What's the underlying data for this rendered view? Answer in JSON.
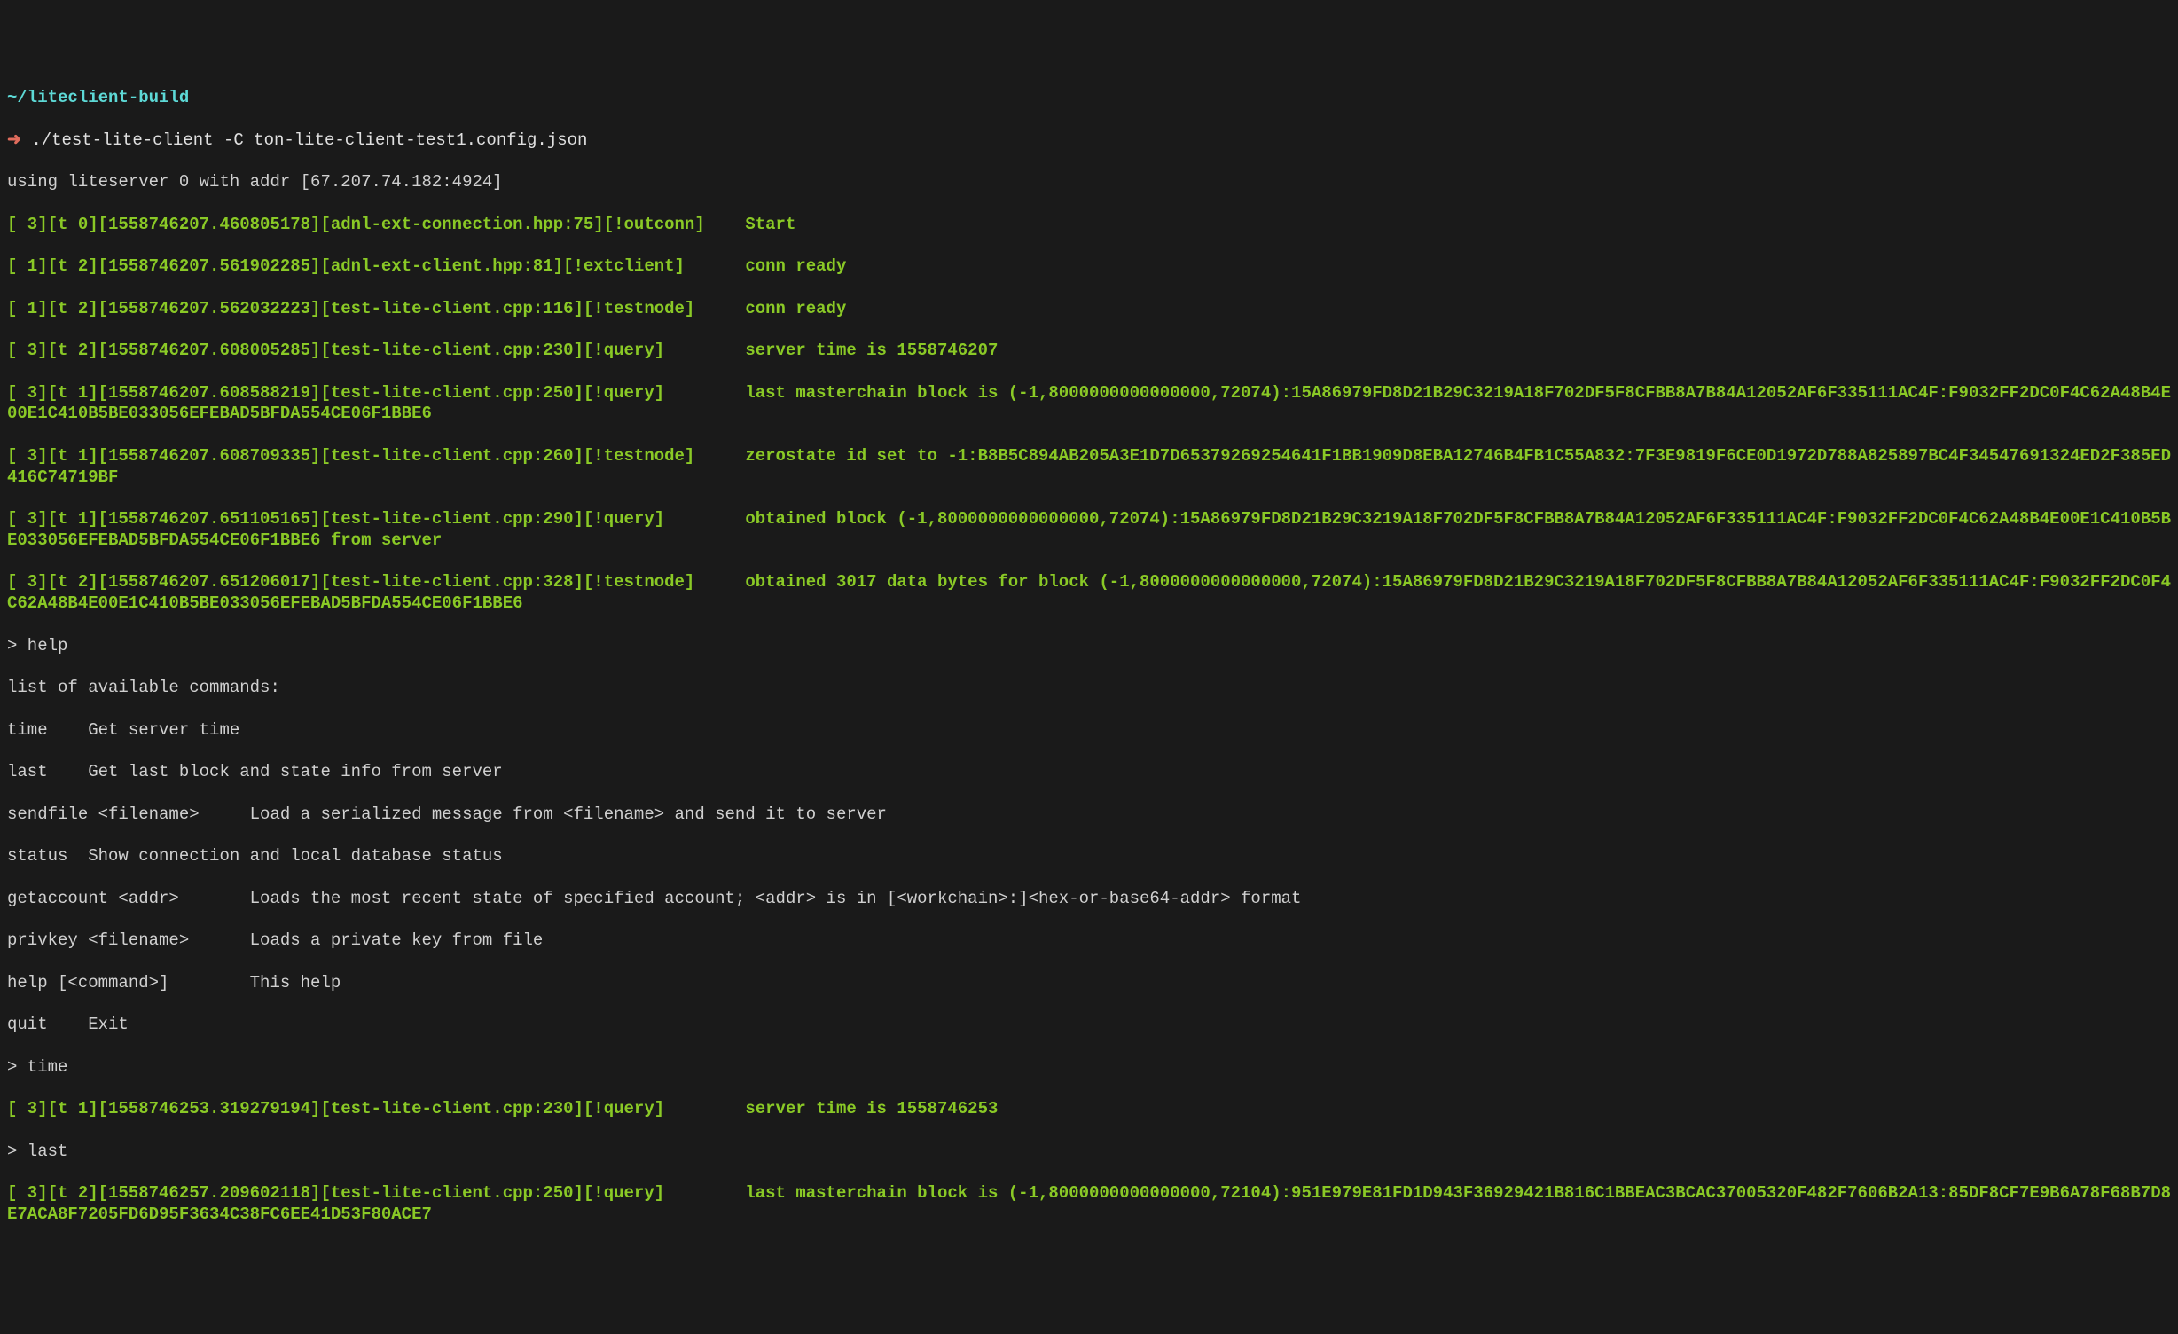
{
  "prompt": {
    "cwd": "~/liteclient-build",
    "arrow": "➜",
    "command": "./test-lite-client -C ton-lite-client-test1.config.json"
  },
  "startup": {
    "using": "using liteserver 0 with addr [67.207.74.182:4924]"
  },
  "logs": {
    "l1": "[ 3][t 0][1558746207.460805178][adnl-ext-connection.hpp:75][!outconn]    Start",
    "l2": "[ 1][t 2][1558746207.561902285][adnl-ext-client.hpp:81][!extclient]      conn ready",
    "l3": "[ 1][t 2][1558746207.562032223][test-lite-client.cpp:116][!testnode]     conn ready",
    "l4": "[ 3][t 2][1558746207.608005285][test-lite-client.cpp:230][!query]        server time is 1558746207",
    "l5": "[ 3][t 1][1558746207.608588219][test-lite-client.cpp:250][!query]        last masterchain block is (-1,8000000000000000,72074):15A86979FD8D21B29C3219A18F702DF5F8CFBB8A7B84A12052AF6F335111AC4F:F9032FF2DC0F4C62A48B4E00E1C410B5BE033056EFEBAD5BFDA554CE06F1BBE6",
    "l6": "[ 3][t 1][1558746207.608709335][test-lite-client.cpp:260][!testnode]     zerostate id set to -1:B8B5C894AB205A3E1D7D65379269254641F1BB1909D8EBA12746B4FB1C55A832:7F3E9819F6CE0D1972D788A825897BC4F34547691324ED2F385ED416C74719BF",
    "l7": "[ 3][t 1][1558746207.651105165][test-lite-client.cpp:290][!query]        obtained block (-1,8000000000000000,72074):15A86979FD8D21B29C3219A18F702DF5F8CFBB8A7B84A12052AF6F335111AC4F:F9032FF2DC0F4C62A48B4E00E1C410B5BE033056EFEBAD5BFDA554CE06F1BBE6 from server",
    "l8": "[ 3][t 2][1558746207.651206017][test-lite-client.cpp:328][!testnode]     obtained 3017 data bytes for block (-1,8000000000000000,72074):15A86979FD8D21B29C3219A18F702DF5F8CFBB8A7B84A12052AF6F335111AC4F:F9032FF2DC0F4C62A48B4E00E1C410B5BE033056EFEBAD5BFDA554CE06F1BBE6"
  },
  "repl": {
    "help_cmd": "> help",
    "help_header": "list of available commands:",
    "help_time": "time    Get server time",
    "help_last": "last    Get last block and state info from server",
    "help_sendfile": "sendfile <filename>     Load a serialized message from <filename> and send it to server",
    "help_status": "status  Show connection and local database status",
    "help_getaccount": "getaccount <addr>       Loads the most recent state of specified account; <addr> is in [<workchain>:]<hex-or-base64-addr> format",
    "help_privkey": "privkey <filename>      Loads a private key from file",
    "help_help": "help [<command>]        This help",
    "help_quit": "quit    Exit",
    "time_cmd": "> time",
    "time_log": "[ 3][t 1][1558746253.319279194][test-lite-client.cpp:230][!query]        server time is 1558746253",
    "last_cmd": "> last",
    "last_log": "[ 3][t 2][1558746257.209602118][test-lite-client.cpp:250][!query]        last masterchain block is (-1,8000000000000000,72104):951E979E81FD1D943F36929421B816C1BBEAC3BCAC37005320F482F7606B2A13:85DF8CF7E9B6A78F68B7D8E7ACA8F7205FD6D95F3634C38FC6EE41D53F80ACE7"
  }
}
